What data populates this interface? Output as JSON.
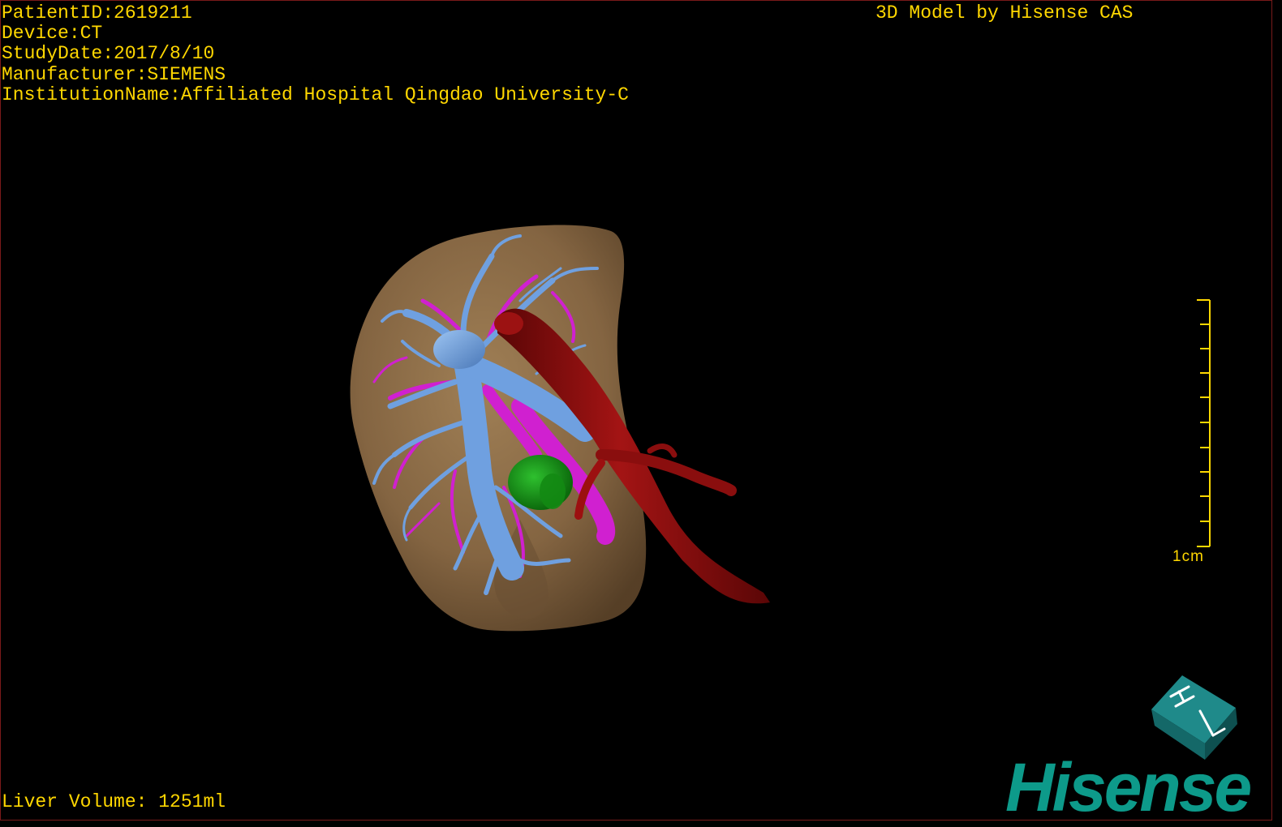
{
  "patient_info": {
    "patient_id": "PatientID:2619211",
    "device": "Device:CT",
    "study_date": "StudyDate:2017/8/10",
    "manufacturer": "Manufacturer:SIEMENS",
    "institution": "InstitutionName:Affiliated Hospital Qingdao University-C"
  },
  "credit": "3D Model by Hisense CAS",
  "liver_volume": "Liver Volume: 1251ml",
  "scale": {
    "label": "1cm"
  },
  "orientation_cube": {
    "icon": "orientation-cube-icon",
    "face_letters": "HL"
  },
  "logo": {
    "text": "Hisense",
    "color": "#0d9a8a"
  },
  "colors": {
    "overlay_text": "#ffd700",
    "liver": "#8b6a45",
    "portal_vein": "#6fa0e0",
    "hepatic_artery": "#d020d0",
    "ivc": "#8a0e0e",
    "lesion": "#1a9a1a",
    "background": "#000000"
  }
}
